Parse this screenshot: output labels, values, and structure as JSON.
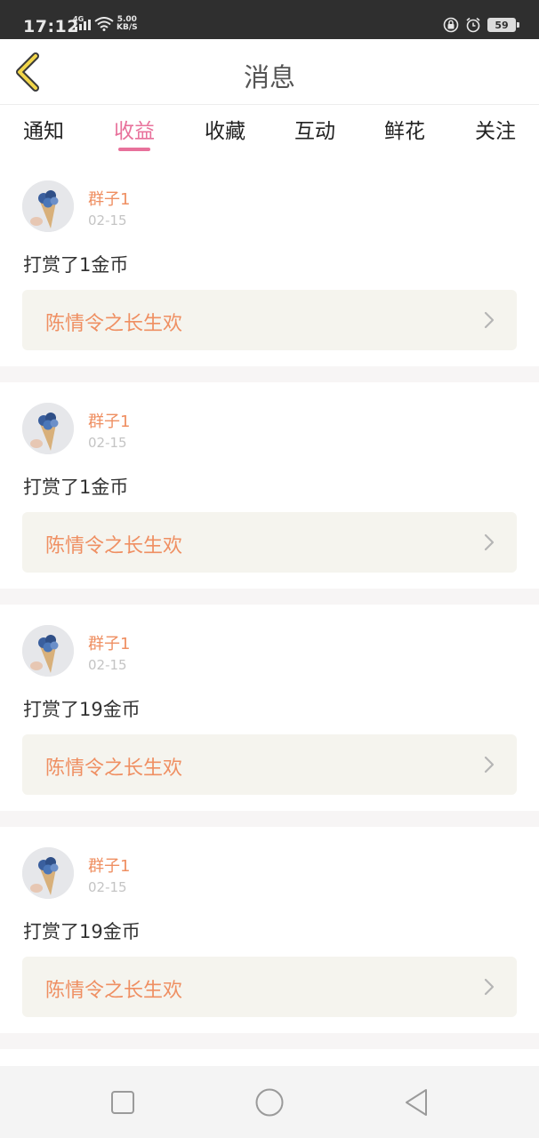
{
  "status_bar": {
    "time": "17:12",
    "network": "4G",
    "speed_value": "5.00",
    "speed_unit": "KB/S",
    "battery": "59"
  },
  "header": {
    "title": "消息",
    "back_icon": "chevron-left-icon"
  },
  "tabs": [
    {
      "label": "通知",
      "active": false
    },
    {
      "label": "收益",
      "active": true
    },
    {
      "label": "收藏",
      "active": false
    },
    {
      "label": "互动",
      "active": false
    },
    {
      "label": "鲜花",
      "active": false
    },
    {
      "label": "关注",
      "active": false
    }
  ],
  "messages": [
    {
      "username": "群子1",
      "date": "02-15",
      "text": "打赏了1金币",
      "work_title": "陈情令之长生欢"
    },
    {
      "username": "群子1",
      "date": "02-15",
      "text": "打赏了1金币",
      "work_title": "陈情令之长生欢"
    },
    {
      "username": "群子1",
      "date": "02-15",
      "text": "打赏了19金币",
      "work_title": "陈情令之长生欢"
    },
    {
      "username": "群子1",
      "date": "02-15",
      "text": "打赏了19金币",
      "work_title": "陈情令之长生欢"
    }
  ],
  "colors": {
    "accent": "#e8719b",
    "username": "#ef8f62",
    "work_box_bg": "#f5f4ee",
    "status_bar_bg": "#2f2f2f"
  },
  "nav_bar": {
    "icons": [
      "square-icon",
      "circle-icon",
      "triangle-back-icon"
    ]
  }
}
